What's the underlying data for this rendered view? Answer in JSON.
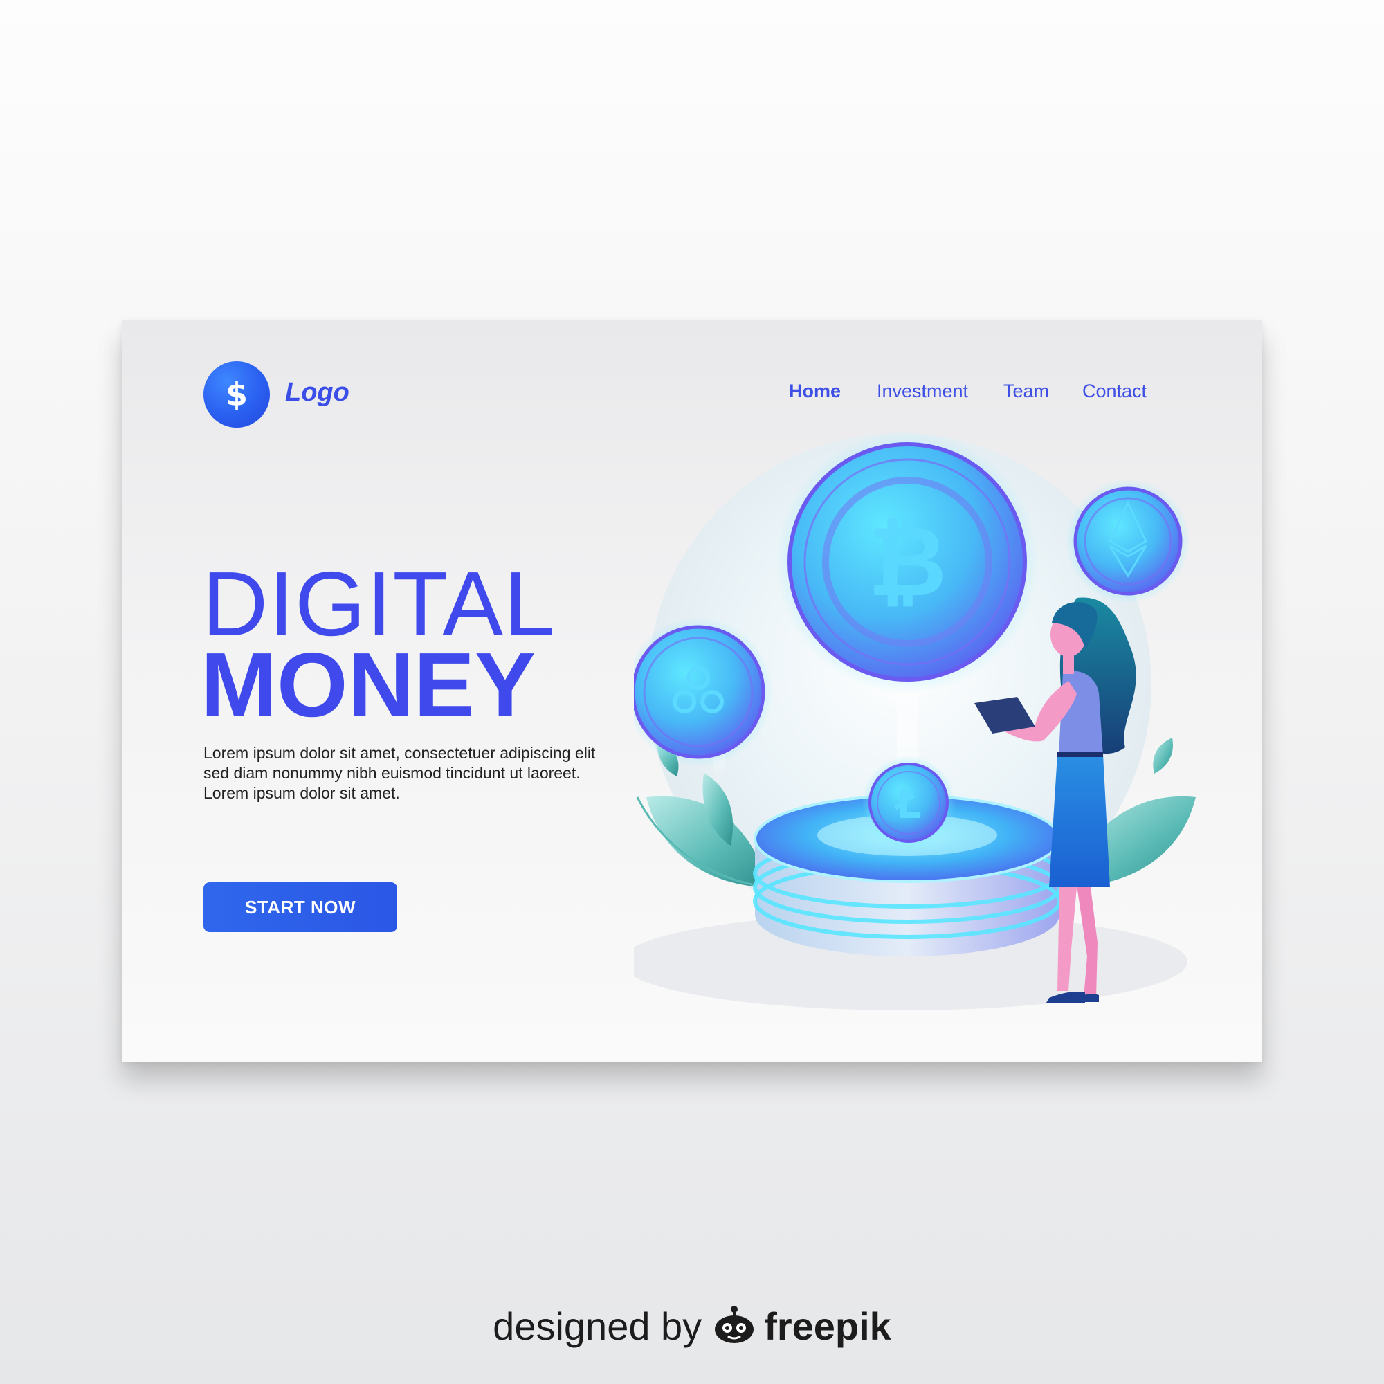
{
  "header": {
    "logo_symbol": "$",
    "logo_text": "Logo",
    "nav": [
      {
        "label": "Home",
        "active": true
      },
      {
        "label": "Investment",
        "active": false
      },
      {
        "label": "Team",
        "active": false
      },
      {
        "label": "Contact",
        "active": false
      }
    ]
  },
  "hero": {
    "title_line1": "DIGITAL",
    "title_line2": "MONEY",
    "description": [
      "Lorem ipsum dolor sit amet, consectetuer adipiscing elit",
      "sed diam nonummy nibh euismod tincidunt ut laoreet.",
      "Lorem ipsum dolor sit amet."
    ],
    "cta_label": "START NOW"
  },
  "illustration": {
    "coins": [
      "bitcoin-coin",
      "ethereum-coin",
      "ripple-coin",
      "litecoin-coin"
    ],
    "figure": "woman-holding-tablet",
    "base": "glowing-coin-stand",
    "colors": {
      "primary": "#3f49ec",
      "glow": "#54d6ff",
      "leaf": "#58b9b4",
      "skin": "#f49ac7"
    }
  },
  "footer": {
    "designed_by": "designed by",
    "brand": "freepik"
  }
}
